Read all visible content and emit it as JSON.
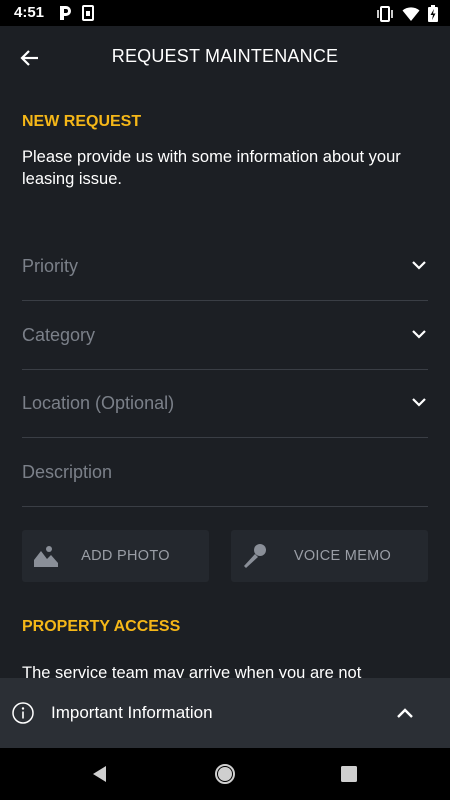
{
  "status_bar": {
    "time": "4:51",
    "left_icons": [
      "parking-app-icon",
      "sim-card-icon"
    ],
    "right_icons": [
      "vibrate-icon",
      "wifi-icon",
      "battery-charging-icon"
    ]
  },
  "app_bar": {
    "title": "REQUEST MAINTENANCE",
    "back_icon": "arrow-back-icon"
  },
  "new_request": {
    "heading": "NEW REQUEST",
    "intro": "Please provide us with some information about your leasing issue."
  },
  "fields": {
    "priority": "Priority",
    "category": "Category",
    "location": "Location (Optional)",
    "description": "Description"
  },
  "actions": {
    "add_photo": "ADD PHOTO",
    "voice_memo": "VOICE MEMO"
  },
  "property_access": {
    "heading": "PROPERTY ACCESS",
    "text": "The service team may arrive when you are not"
  },
  "info_bar": {
    "label": "Important Information"
  },
  "colors": {
    "background": "#1c1f24",
    "accent": "#f5b718",
    "placeholder": "#7b8089",
    "button_bg": "#24282e",
    "info_bar_bg": "#2b2f35"
  }
}
